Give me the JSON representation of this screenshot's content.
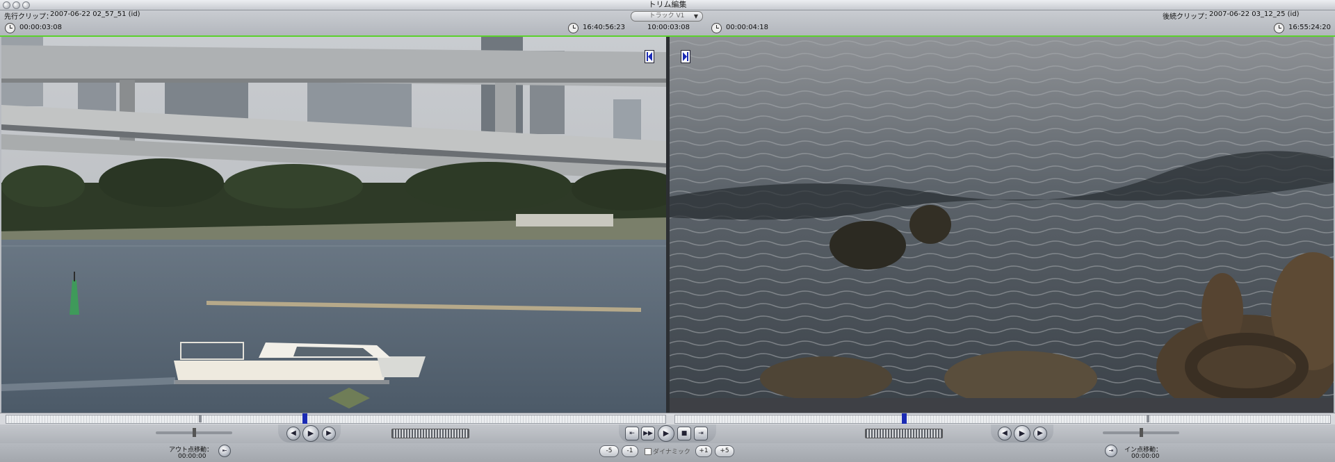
{
  "window": {
    "title": "トリム編集"
  },
  "header": {
    "left_clip_label": "先行クリップ：",
    "left_clip_name": "2007-06-22 02_57_51 (id)",
    "left_duration": "00:00:03:08",
    "center_left_timecode": "16:40:56:23",
    "center_timecode": "10:00:03:08",
    "track_select_value": "トラック V1",
    "center_right_duration": "00:00:04:18",
    "right_clip_label": "後続クリップ：",
    "right_clip_name": "2007-06-22 03_12_25 (id)",
    "right_timecode": "16:55:24:20"
  },
  "controls": {
    "prev_edit": "◀",
    "play": "▶",
    "next_edit": "▶",
    "go_prev": "⇤",
    "play_in_out": "▶▶",
    "play_around": "▶",
    "stop": "■",
    "go_next": "⇥"
  },
  "bottom": {
    "out_point_label": "アウト点移動：",
    "out_point_value": "00:00:00",
    "in_point_label": "イン点移動：",
    "in_point_value": "00:00:00",
    "minus5": "-5",
    "minus1": "-1",
    "dynamic_label": "ダイナミック",
    "plus1": "+1",
    "plus5": "+5"
  },
  "colors": {
    "accent_green": "#5bd22c",
    "playhead_blue": "#1b2bb4"
  }
}
